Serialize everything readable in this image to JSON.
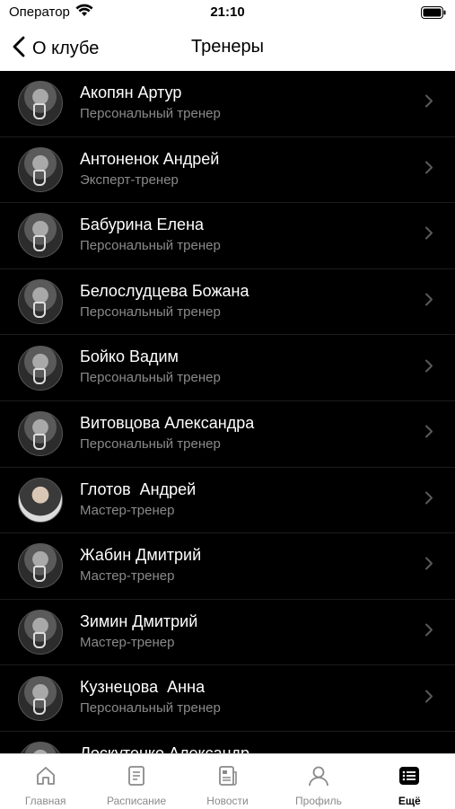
{
  "status_bar": {
    "carrier": "Оператор",
    "time": "21:10"
  },
  "nav": {
    "back_label": "О клубе",
    "title": "Тренеры"
  },
  "trainers": [
    {
      "name": "Акопян Артур",
      "role": "Персональный тренер"
    },
    {
      "name": "Антоненок Андрей",
      "role": "Эксперт-тренер"
    },
    {
      "name": "Бабурина Елена",
      "role": "Персональный тренер"
    },
    {
      "name": "Белослудцева Божана",
      "role": "Персональный тренер"
    },
    {
      "name": "Бойко Вадим",
      "role": "Персональный тренер"
    },
    {
      "name": "Витовцова Александра",
      "role": "Персональный тренер"
    },
    {
      "name": "Глотов  Андрей",
      "role": "Мастер-тренер"
    },
    {
      "name": "Жабин Дмитрий",
      "role": "Мастер-тренер"
    },
    {
      "name": "Зимин Дмитрий",
      "role": "Мастер-тренер"
    },
    {
      "name": "Кузнецова  Анна",
      "role": "Персональный тренер"
    },
    {
      "name": "Лоскутенко Александр",
      "role": ""
    }
  ],
  "tabs": [
    {
      "label": "Главная",
      "icon": "home-icon"
    },
    {
      "label": "Расписание",
      "icon": "schedule-icon"
    },
    {
      "label": "Новости",
      "icon": "news-icon"
    },
    {
      "label": "Профиль",
      "icon": "profile-icon"
    },
    {
      "label": "Ещё",
      "icon": "more-icon",
      "active": true
    }
  ],
  "colors": {
    "list_bg": "#000000",
    "name": "#ffffff",
    "role": "#8a8a8a",
    "tab_inactive": "#8a8a8a",
    "tab_active": "#000000"
  }
}
